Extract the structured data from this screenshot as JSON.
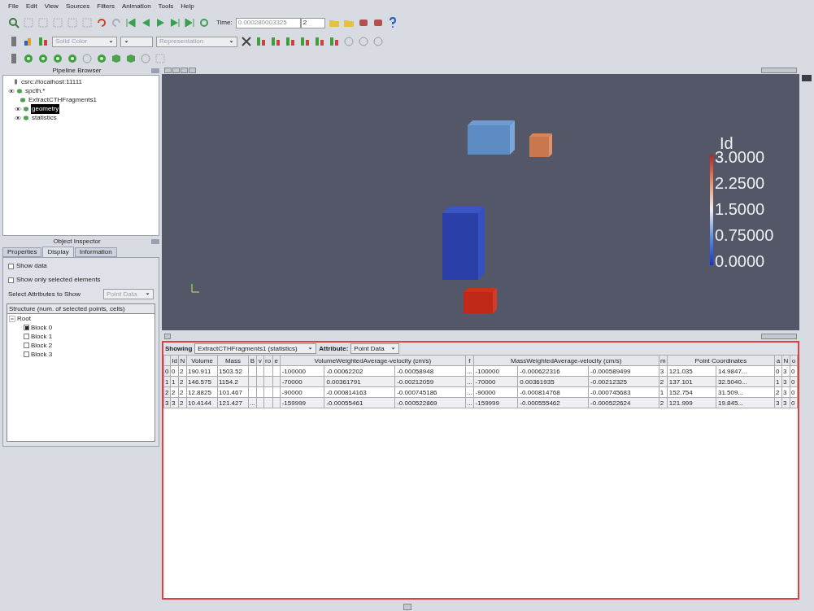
{
  "menu": [
    "File",
    "Edit",
    "View",
    "Sources",
    "Filters",
    "Animation",
    "Tools",
    "Help"
  ],
  "toolbar": {
    "time_label": "Time:",
    "time_value": "0.000280003325",
    "time_step": "2",
    "color_by": {
      "value": "Solid Color",
      "disabled": true
    },
    "representation": {
      "value": "Representation",
      "disabled": true
    }
  },
  "pipeline_browser": {
    "title": "Pipeline Browser",
    "items": [
      {
        "label": "csrc://localhost:11111",
        "kind": "server",
        "selected": false,
        "children": [
          {
            "label": "spcth.*",
            "kind": "source",
            "visible": true,
            "selected": false,
            "children": [
              {
                "label": "ExtractCTHFragments1",
                "kind": "source",
                "selected": false,
                "children": [
                  {
                    "label": "geometry",
                    "kind": "source",
                    "visible": true,
                    "selected": true
                  },
                  {
                    "label": "statistics",
                    "kind": "source",
                    "visible": true,
                    "selected": false
                  }
                ]
              }
            ]
          }
        ]
      }
    ]
  },
  "object_inspector": {
    "title": "Object Inspector",
    "tabs": [
      {
        "label": "Properties",
        "selected": false
      },
      {
        "label": "Display",
        "selected": true
      },
      {
        "label": "Information",
        "selected": false
      }
    ],
    "options": [
      {
        "label": "Show data",
        "checked": false
      },
      {
        "label": "Show only selected elements",
        "checked": false
      }
    ],
    "attributes_label": "Select Attributes to Show",
    "attributes_value": {
      "value": "Point Data",
      "disabled": true
    },
    "structure_header": "Structure (num. of selected points, cells)",
    "structure": [
      {
        "label": "Root",
        "expanded": true,
        "children": [
          {
            "label": "Block 0",
            "checked": true
          },
          {
            "label": "Block 1",
            "checked": false
          },
          {
            "label": "Block 2",
            "checked": false
          },
          {
            "label": "Block 3",
            "checked": false
          }
        ]
      }
    ]
  },
  "render_view": {
    "legend": {
      "title": "Id",
      "labels": [
        "3.0000",
        "2.2500",
        "1.5000",
        "0.75000",
        "0.0000"
      ]
    }
  },
  "spreadsheet": {
    "showing_label": "Showing",
    "source": "ExtractCTHFragments1 (statistics)",
    "attribute_label": "Attribute:",
    "attribute": "Point Data",
    "columns": [
      "Id",
      "N",
      "Volume",
      "Mass",
      "B",
      "v",
      "ro",
      "e",
      "VolumeWeightedAverage-velocity (cm/s)",
      "f",
      "MassWeightedAverage-velocity (cm/s)",
      "m",
      "Point Coordinates",
      "a",
      "N",
      "o"
    ],
    "rows": [
      {
        "index": "0",
        "cells": [
          "0",
          "2",
          "190.911",
          "1503.52",
          null,
          null,
          null,
          null,
          [
            "-100000",
            "-0.00062202",
            "-0.00058948"
          ],
          "...",
          [
            "-100000",
            "-0.000622316",
            "-0.000589499"
          ],
          "3",
          [
            "121.035",
            "14.9847..."
          ],
          "0",
          "3",
          "0"
        ]
      },
      {
        "index": "1",
        "cells": [
          "1",
          "2",
          "146.575",
          "1154.2",
          null,
          null,
          null,
          null,
          [
            "-70000",
            "0.00361791",
            "-0.00212059"
          ],
          "...",
          [
            "-70000",
            "0.00361935",
            "-0.00212325"
          ],
          "2",
          [
            "137.101",
            "32.5040..."
          ],
          "1",
          "3",
          "0"
        ]
      },
      {
        "index": "2",
        "cells": [
          "2",
          "2",
          "12.8825",
          "101.467",
          null,
          null,
          null,
          null,
          [
            "-90000",
            "-0.000814163",
            "-0.000745186"
          ],
          "...",
          [
            "-90000",
            "-0.000814768",
            "-0.000745683"
          ],
          "1",
          [
            "152.754",
            "31.509..."
          ],
          "2",
          "3",
          "0"
        ]
      },
      {
        "index": "3",
        "cells": [
          "3",
          "2",
          "10.4144",
          "121.427",
          "...",
          null,
          null,
          null,
          [
            "-159999",
            "-0.00055461",
            "-0.000522869"
          ],
          "...",
          [
            "-159999",
            "-0.000555462",
            "-0.000522624"
          ],
          "2",
          [
            "121.999",
            "19.845..."
          ],
          "3",
          "3",
          "0"
        ]
      }
    ]
  }
}
